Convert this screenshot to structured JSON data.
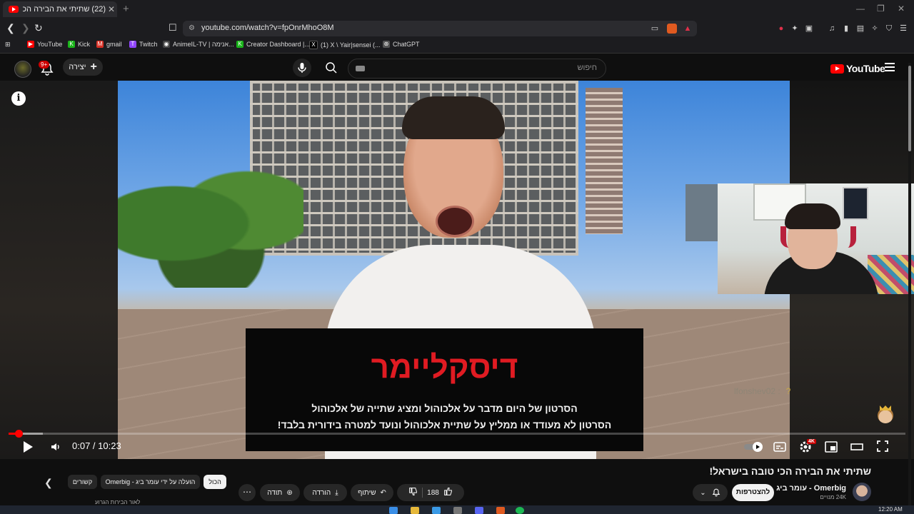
{
  "browser": {
    "tab_title": "(22) שתיתי את הבירה הכי טובה |",
    "tab_close": "✕",
    "new_tab": "+",
    "url": "youtube.com/watch?v=fpOnrMhoO8M",
    "window_controls": [
      "—",
      "❐",
      "✕"
    ],
    "bookmarks": [
      {
        "label": "YouTube",
        "icon": "youtube-icon",
        "color": "#ff0000",
        "glyph": "▶"
      },
      {
        "label": "Kick",
        "icon": "kick-icon",
        "color": "#1bb51b",
        "glyph": "K"
      },
      {
        "label": "gmail",
        "icon": "gmail-icon",
        "color": "#d93025",
        "glyph": "M"
      },
      {
        "label": "Twitch",
        "icon": "twitch-icon",
        "color": "#9146ff",
        "glyph": "T"
      },
      {
        "label": "AnimeIL-TV | אנימה...",
        "icon": "animeil-icon",
        "color": "#444444",
        "glyph": "◉"
      },
      {
        "label": "Creator Dashboard |...",
        "icon": "kick-icon",
        "color": "#1bb51b",
        "glyph": "K"
      },
      {
        "label": "(1) X \\ Yair|sensei (...",
        "icon": "x-icon",
        "color": "#000000",
        "glyph": "X"
      },
      {
        "label": "ChatGPT",
        "icon": "chatgpt-icon",
        "color": "#555555",
        "glyph": "⊛"
      }
    ]
  },
  "youtube": {
    "logo_text": "YouTube",
    "search_placeholder": "חיפוש",
    "create_label": "יצירה",
    "notification_count": "9+"
  },
  "player": {
    "disclaimer_title": "דיסקליימר",
    "disclaimer_line1": "הסרטון של היום מדבר על אלכוהול ומציג שתייה של אלכוהול",
    "disclaimer_line2": "הסרטון לא מעודד או ממליץ על שתיית אלכוהול ונועד למטרה בידורית בלבד!",
    "time_display": "0:07 / 10:23",
    "progress_fraction": 0.011,
    "buffered_fraction": 0.038,
    "chat_overlay": "lfonshev02 :",
    "chat_overlay_mark": "?",
    "quality_badge": "4K"
  },
  "video_info": {
    "title": "שתיתי את הבירה הכי טובה בישראל!",
    "channel_name": "Omerbig - עומר ביג",
    "subscribers": "24K מנויים",
    "subscribe_label": "להצטרפות",
    "like_count": "188",
    "share_label": "שיתוף",
    "download_label": "הורדה",
    "thanks_label": "תודה",
    "more_label": "⋯"
  },
  "chips": [
    {
      "label": "הכול",
      "active": true
    },
    {
      "label": "הועלה על ידי עומר ביג - Omerbig",
      "active": false
    },
    {
      "label": "קשורים",
      "active": false
    }
  ],
  "preview_text": "לאור הבירות הגרוע",
  "taskbar": {
    "clock": "12:20 AM"
  }
}
